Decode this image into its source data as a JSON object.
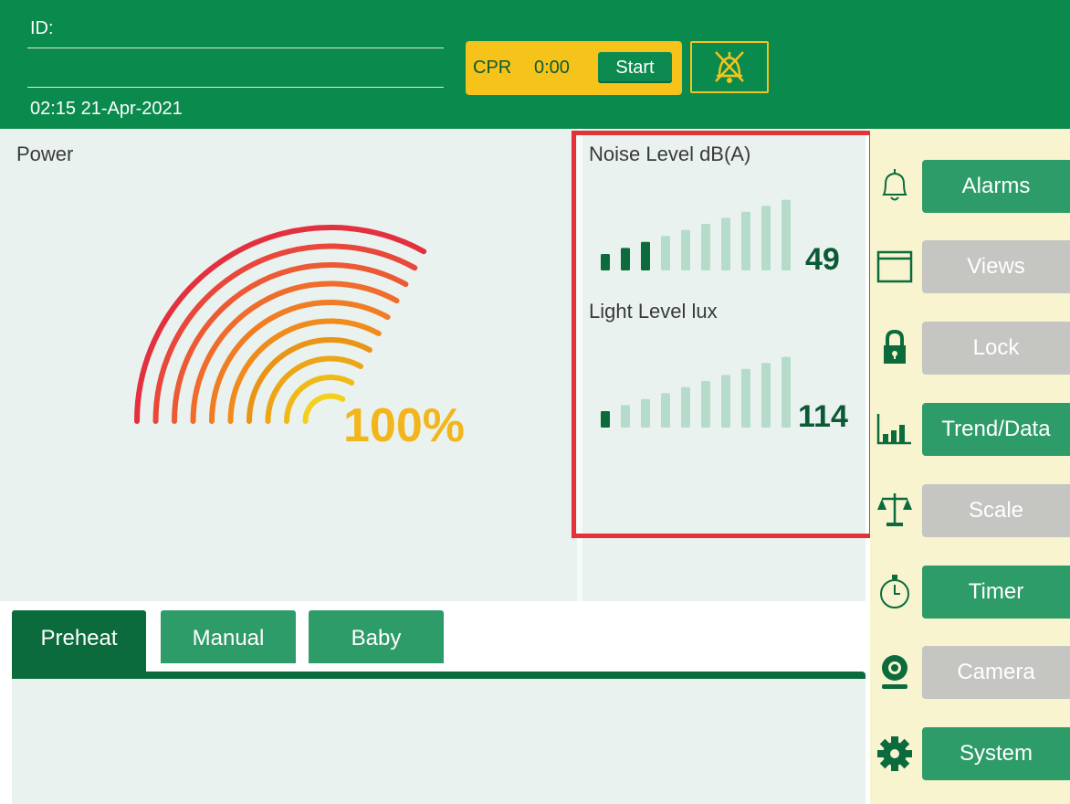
{
  "header": {
    "id_label": "ID:",
    "datetime": "02:15 21-Apr-2021",
    "cpr": {
      "label": "CPR",
      "time": "0:00",
      "start_label": "Start"
    },
    "alarm_silence_icon": "alarm-bell-silenced-icon"
  },
  "power": {
    "title": "Power",
    "value": "100%",
    "level": 1.0
  },
  "noise": {
    "title": "Noise Level dB(A)",
    "value": "49",
    "bars_active": 3,
    "bars_total": 10
  },
  "light": {
    "title": "Light Level lux",
    "value": "114",
    "bars_active": 1,
    "bars_total": 10
  },
  "tabs": [
    {
      "label": "Preheat",
      "selected": true
    },
    {
      "label": "Manual",
      "selected": false
    },
    {
      "label": "Baby",
      "selected": false
    }
  ],
  "sidebar": {
    "items": [
      {
        "label": "Alarms",
        "icon": "bell-icon",
        "enabled": true
      },
      {
        "label": "Views",
        "icon": "window-icon",
        "enabled": false
      },
      {
        "label": "Lock",
        "icon": "lock-icon",
        "enabled": false
      },
      {
        "label": "Trend/Data",
        "icon": "bar-chart-icon",
        "enabled": true
      },
      {
        "label": "Scale",
        "icon": "scale-icon",
        "enabled": false
      },
      {
        "label": "Timer",
        "icon": "stopwatch-icon",
        "enabled": true
      },
      {
        "label": "Camera",
        "icon": "webcam-icon",
        "enabled": false
      },
      {
        "label": "System",
        "icon": "gear-icon",
        "enabled": true
      }
    ]
  },
  "colors": {
    "header_green": "#0a8a4d",
    "dark_green": "#0b6b3c",
    "button_green": "#2e9c69",
    "cpr_yellow": "#f6c31a",
    "highlight_red": "#e53238",
    "sidebar_bg": "#f7f4cf",
    "inactive_gray": "#c5c5c2"
  }
}
